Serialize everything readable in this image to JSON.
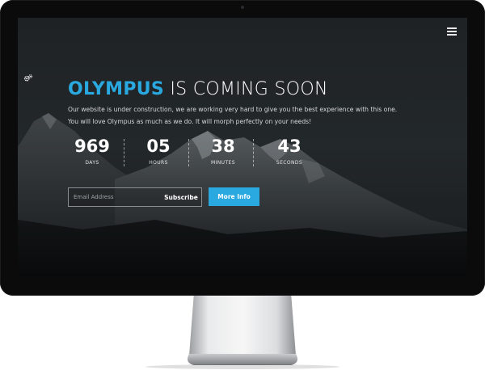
{
  "page": {
    "brand": "OLYMPUS",
    "headline_rest": " IS COMING SOON",
    "description_line1": "Our website is under construction, we are working very hard to give you the best experience with this one.",
    "description_line2": "You will love Olympus as much as we do. It will morph perfectly on your needs!"
  },
  "countdown": [
    {
      "value": "969",
      "label": "DAYS"
    },
    {
      "value": "05",
      "label": "HOURS"
    },
    {
      "value": "38",
      "label": "MINUTES"
    },
    {
      "value": "43",
      "label": "SECONDS"
    }
  ],
  "form": {
    "email_placeholder": "Email Address",
    "email_value": "",
    "subscribe_label": "Subscribe",
    "more_info_label": "More Info"
  },
  "icons": {
    "menu": "hamburger-menu-icon",
    "settings": "gears-icon"
  },
  "colors": {
    "accent": "#2aa8e0",
    "background": "#1b1e21",
    "bezel": "#0b0b0c",
    "text": "#ffffff"
  }
}
